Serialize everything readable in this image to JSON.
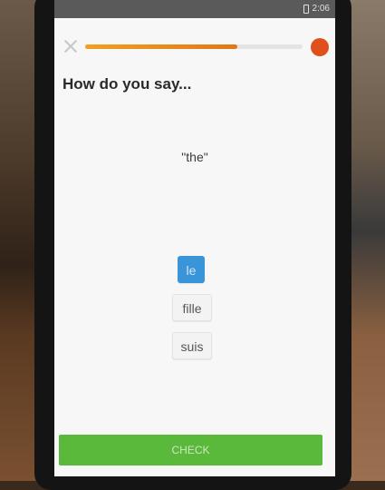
{
  "statusbar": {
    "time": "2:06",
    "battery_icon": "battery-icon"
  },
  "header": {
    "close_icon": "close-icon",
    "progress_fraction": 0.7,
    "progress_color": "#e88a1e",
    "heart_badge_text": "",
    "heart_badge_color": "#e0501a"
  },
  "question": {
    "title": "How do you say...",
    "prompt": "\"the\""
  },
  "choices": [
    {
      "label": "le",
      "selected": true
    },
    {
      "label": "fille",
      "selected": false
    },
    {
      "label": "suis",
      "selected": false
    }
  ],
  "footer": {
    "check_label": "CHECK",
    "check_color": "#5ab83a"
  },
  "colors": {
    "selected": "#3a94d8",
    "accent": "#e88a1e"
  }
}
